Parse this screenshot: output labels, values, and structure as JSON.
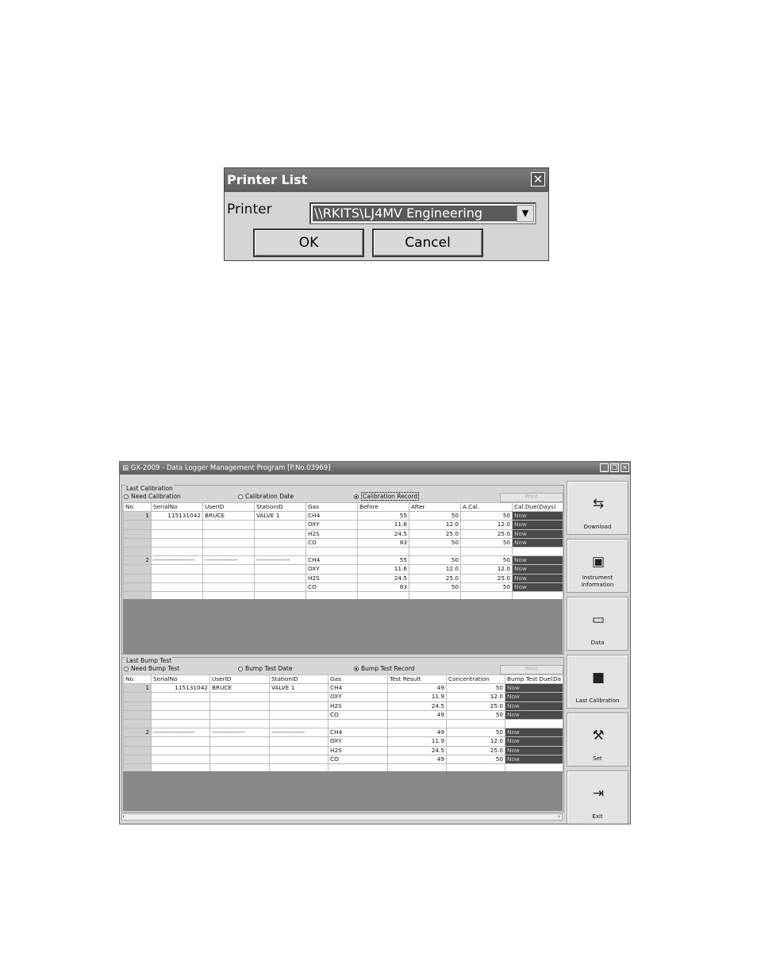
{
  "dialog": {
    "title": "Printer List",
    "printer_label": "Printer",
    "printer_value": "\\\\RKITS\\LJ4MV Engineering",
    "ok_label": "OK",
    "cancel_label": "Cancel"
  },
  "window": {
    "title": "GX-2009 - Data Logger Management Program [P.No.03969]"
  },
  "calibration": {
    "group_title": "Last Calibration",
    "radios": [
      "Need Calibration",
      "Calibration Date",
      "Calibration Record"
    ],
    "selected_radio": "Calibration Record",
    "print_label": "Print",
    "columns": [
      "No.",
      "SerialNo",
      "UserID",
      "StationID",
      "Gas",
      "Before",
      "After",
      "A.Cal.",
      "Cal.Due(Days)"
    ],
    "rows": [
      [
        "1",
        "115131042",
        "BRUCE",
        "VALVE 1",
        "CH4",
        "55",
        "50",
        "50",
        "Now"
      ],
      [
        "",
        "",
        "",
        "",
        "OXY",
        "11.6",
        "12.0",
        "12.0",
        "Now"
      ],
      [
        "",
        "",
        "",
        "",
        "H2S",
        "24.5",
        "25.0",
        "25.0",
        "Now"
      ],
      [
        "",
        "",
        "",
        "",
        "CO",
        "83",
        "50",
        "50",
        "Now"
      ],
      [
        "",
        "",
        "",
        "",
        "",
        "",
        "",
        "",
        ""
      ],
      [
        "2",
        "--------------------",
        "----------------",
        "----------------",
        "CH4",
        "55",
        "50",
        "50",
        "Now"
      ],
      [
        "",
        "",
        "",
        "",
        "OXY",
        "11.6",
        "12.0",
        "12.0",
        "Now"
      ],
      [
        "",
        "",
        "",
        "",
        "H2S",
        "24.5",
        "25.0",
        "25.0",
        "Now"
      ],
      [
        "",
        "",
        "",
        "",
        "CO",
        "83",
        "50",
        "50",
        "Now"
      ],
      [
        "",
        "",
        "",
        "",
        "",
        "",
        "",
        "",
        ""
      ]
    ]
  },
  "bump": {
    "group_title": "Last Bump Test",
    "radios": [
      "Need Bump Test",
      "Bump Test Date",
      "Bump Test Record"
    ],
    "selected_radio": "Bump Test Record",
    "print_label": "Print",
    "columns": [
      "No.",
      "SerialNo",
      "UserID",
      "StationID",
      "Gas",
      "Test Result",
      "Concentration",
      "Bump Test Due(Da"
    ],
    "rows": [
      [
        "1",
        "115131042",
        "BRUCE",
        "VALVE 1",
        "CH4",
        "49",
        "50",
        "Now"
      ],
      [
        "",
        "",
        "",
        "",
        "OXY",
        "11.9",
        "12.0",
        "Now"
      ],
      [
        "",
        "",
        "",
        "",
        "H2S",
        "24.5",
        "25.0",
        "Now"
      ],
      [
        "",
        "",
        "",
        "",
        "CO",
        "49",
        "50",
        "Now"
      ],
      [
        "",
        "",
        "",
        "",
        "",
        "",
        "",
        ""
      ],
      [
        "2",
        "--------------------",
        "----------------",
        "----------------",
        "CH4",
        "49",
        "50",
        "Now"
      ],
      [
        "",
        "",
        "",
        "",
        "OXY",
        "11.9",
        "12.0",
        "Now"
      ],
      [
        "",
        "",
        "",
        "",
        "H2S",
        "24.5",
        "25.0",
        "Now"
      ],
      [
        "",
        "",
        "",
        "",
        "CO",
        "49",
        "50",
        "Now"
      ],
      [
        "",
        "",
        "",
        "",
        "",
        "",
        "",
        ""
      ]
    ]
  },
  "side_buttons": [
    {
      "label": "Download",
      "icon": "download-icon",
      "glyph": "⇆"
    },
    {
      "label": "Instrument Information",
      "icon": "instrument-icon",
      "glyph": "▣"
    },
    {
      "label": "Data",
      "icon": "folder-icon",
      "glyph": "▭"
    },
    {
      "label": "Last Calibration",
      "icon": "book-icon",
      "glyph": "■"
    },
    {
      "label": "Set",
      "icon": "tools-icon",
      "glyph": "⚒"
    },
    {
      "label": "Exit",
      "icon": "exit-icon",
      "glyph": "⇥"
    }
  ]
}
